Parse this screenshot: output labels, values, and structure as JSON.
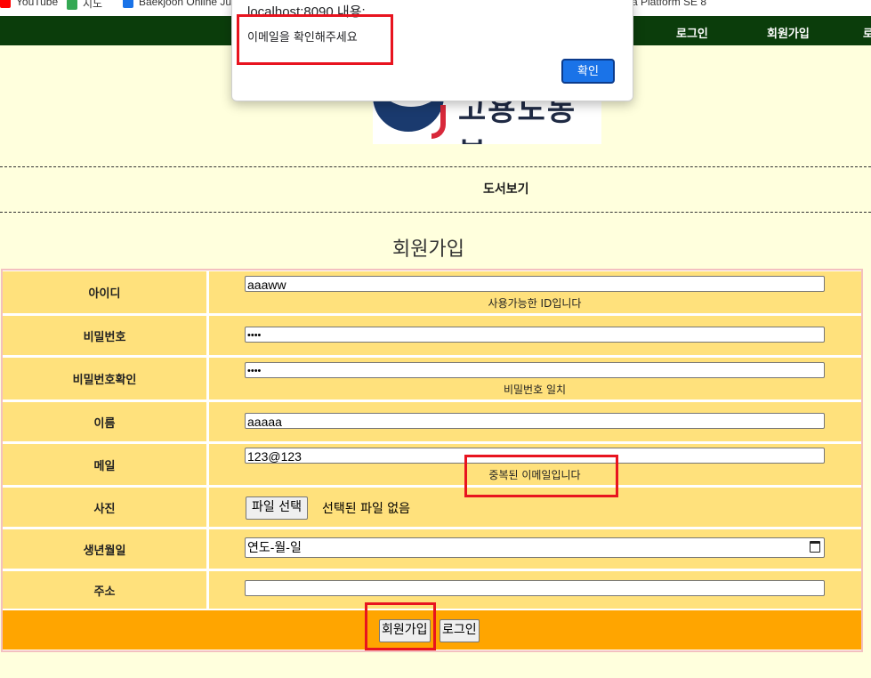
{
  "bookmarks": [
    {
      "label": "YouTube",
      "color": "#ff0000"
    },
    {
      "label": "지도",
      "color": "#34a853"
    },
    {
      "label": "Baekjoon Online Ju",
      "color": "#1a73e8"
    },
    {
      "label": "a Platform SE 8",
      "color": "#888888"
    }
  ],
  "topnav": {
    "login": "로그인",
    "signup": "회원가입",
    "extra": "로"
  },
  "logo": {
    "text": "고용노동부"
  },
  "menu": {
    "books": "도서보기"
  },
  "page_title": "회원가입",
  "form": {
    "id": {
      "label": "아이디",
      "value": "aaaww",
      "message": "사용가능한 ID입니다"
    },
    "password": {
      "label": "비밀번호",
      "value": "••••"
    },
    "password_confirm": {
      "label": "비밀번호확인",
      "value": "••••",
      "message": "비밀번호 일치"
    },
    "name": {
      "label": "이름",
      "value": "aaaaa"
    },
    "email": {
      "label": "메일",
      "value": "123@123",
      "message": "중복된 이메일입니다"
    },
    "photo": {
      "label": "사진",
      "button": "파일 선택",
      "status": "선택된 파일 없음"
    },
    "birth": {
      "label": "생년월일",
      "placeholder": "연도-월-일"
    },
    "address": {
      "label": "주소",
      "value": ""
    }
  },
  "actions": {
    "signup": "회원가입",
    "login": "로그인"
  },
  "dialog": {
    "title": "localhost:8090 내용:",
    "message": "이메일을 확인해주세요",
    "ok": "확인"
  },
  "colors": {
    "nav": "#0b3d0b",
    "page_bg": "#ffffdd",
    "cell_bg": "#ffe17c",
    "actions_bg": "#ffa500",
    "highlight": "#e8141f",
    "dialog_button": "#1a73e8"
  }
}
